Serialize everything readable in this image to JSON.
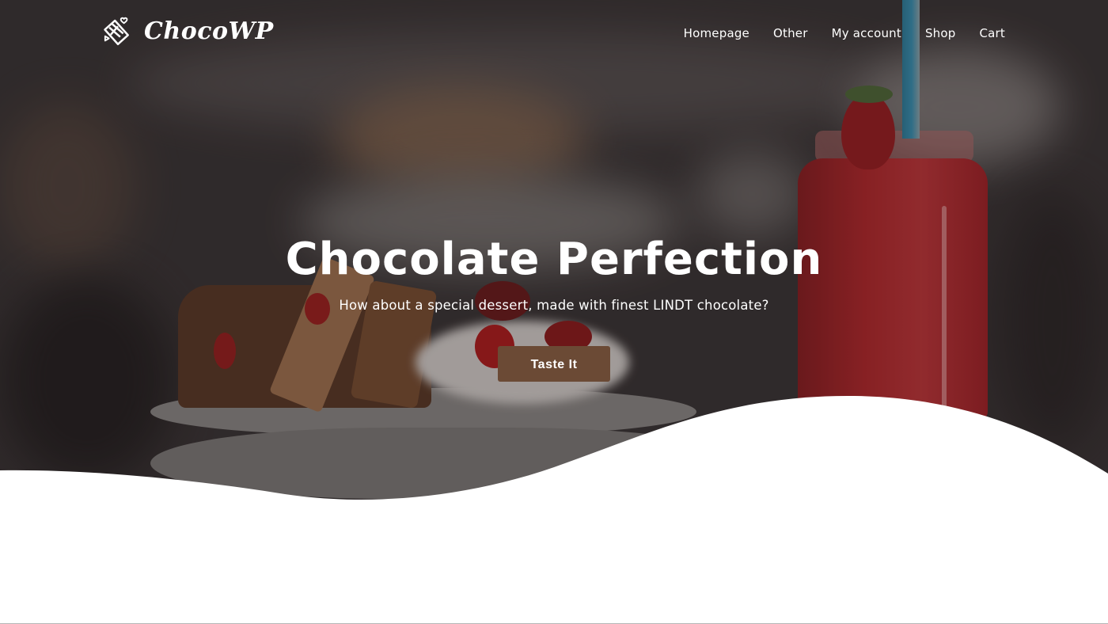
{
  "site": {
    "brand": "ChocoWP",
    "logo_icon": "chocolate-bar-hearts-icon"
  },
  "nav": {
    "items": [
      {
        "label": "Homepage"
      },
      {
        "label": "Other"
      },
      {
        "label": "My account"
      },
      {
        "label": "Shop"
      },
      {
        "label": "Cart"
      }
    ]
  },
  "hero": {
    "title": "Chocolate Perfection",
    "subtitle": "How about a special dessert, made with finest LINDT chocolate?",
    "cta_label": "Taste It",
    "background_image": "waffles-with-chocolate-strawberries-and-smoothie-jar",
    "colors": {
      "cta": "#6b4a35",
      "text": "#ffffff",
      "wave": "#ffffff"
    }
  }
}
